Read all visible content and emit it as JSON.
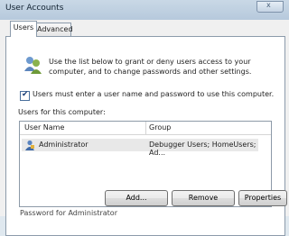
{
  "window": {
    "title": "User Accounts",
    "close_label": "x"
  },
  "tabs": [
    {
      "label": "Users",
      "selected": true
    },
    {
      "label": "Advanced",
      "selected": false
    }
  ],
  "info_text": "Use the list below to grant or deny users access to your computer, and to change passwords and other settings.",
  "checkbox": {
    "checked": true,
    "label": "Users must enter a user name and password to use this computer."
  },
  "list": {
    "label": "Users for this computer:",
    "columns": [
      "User Name",
      "Group"
    ],
    "rows": [
      {
        "user": "Administrator",
        "group": "Debugger Users; HomeUsers; Ad..."
      }
    ]
  },
  "buttons": {
    "add": "Add...",
    "remove": "Remove",
    "properties": "Properties"
  },
  "cut_text": "Password for Administrator",
  "colors": {
    "titlebar": "#b6c9dc",
    "selected_row": "#e8e8e8",
    "panel": "#ffffff"
  }
}
